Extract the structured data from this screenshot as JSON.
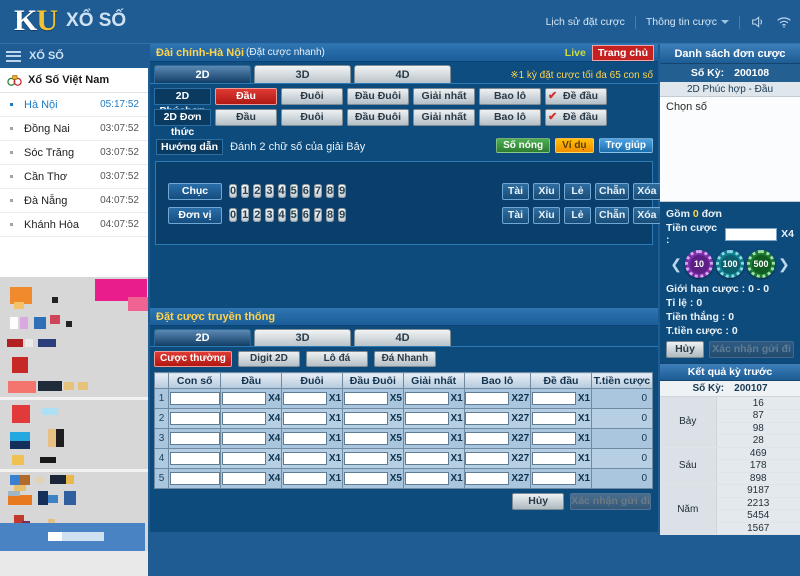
{
  "topbar": {
    "logo_main": "KU",
    "logo_sub": "XỔ SỐ",
    "links": [
      {
        "label": "Lịch sử đặt cược",
        "icon": ""
      },
      {
        "label": "Thông tin cược",
        "icon": "chevron-down-icon"
      }
    ],
    "icons": [
      "volume-icon",
      "wifi-icon"
    ]
  },
  "sidebar": {
    "header": "XỔ SỐ",
    "country": "Xổ Số Việt Nam",
    "provinces": [
      {
        "name": "Hà Nội",
        "time": "05:17:52",
        "active": true
      },
      {
        "name": "Đồng Nai",
        "time": "03:07:52",
        "active": false
      },
      {
        "name": "Sóc Trăng",
        "time": "03:07:52",
        "active": false
      },
      {
        "name": "Cần Thơ",
        "time": "03:07:52",
        "active": false
      },
      {
        "name": "Đà Nẵng",
        "time": "04:07:52",
        "active": false
      },
      {
        "name": "Khánh Hòa",
        "time": "04:07:52",
        "active": false
      }
    ]
  },
  "quickbet": {
    "title": "Đài chính-Hà Nội",
    "title_sub": "(Đặt cược nhanh)",
    "live_label": "Live",
    "home_label": "Trang chủ",
    "tabs": [
      {
        "label": "2D",
        "selected": true
      },
      {
        "label": "3D",
        "selected": false
      },
      {
        "label": "4D",
        "selected": false
      }
    ],
    "note": "※1 kỳ đặt cược tối đa 65 con số",
    "rows": [
      {
        "label": "2D Phúchợp",
        "buttons": [
          {
            "label": "Đầu",
            "style": "red"
          },
          {
            "label": "Đuôi",
            "style": "normal"
          },
          {
            "label": "Đầu Đuôi",
            "style": "normal"
          },
          {
            "label": "Giải nhất",
            "style": "normal"
          },
          {
            "label": "Bao lô",
            "style": "normal"
          },
          {
            "label": "Đề đầu",
            "style": "flag"
          }
        ]
      },
      {
        "label": "2D Đơn thức",
        "buttons": [
          {
            "label": "Đầu",
            "style": "normal"
          },
          {
            "label": "Đuôi",
            "style": "normal"
          },
          {
            "label": "Đầu Đuôi",
            "style": "normal"
          },
          {
            "label": "Giải nhất",
            "style": "normal"
          },
          {
            "label": "Bao lô",
            "style": "normal"
          },
          {
            "label": "Đề đầu",
            "style": "flag"
          }
        ]
      }
    ],
    "guide_tag": "Hướng dẫn",
    "guide_text": "Đánh 2 chữ số của giải Bảy",
    "guide_buttons": [
      {
        "label": "Số nóng",
        "color": "green"
      },
      {
        "label": "Ví dụ",
        "color": "orange"
      },
      {
        "label": "Trợ giúp",
        "color": "blue"
      }
    ],
    "pad": {
      "row1_name": "Chục",
      "row2_name": "Đơn vị",
      "digits": [
        "0",
        "1",
        "2",
        "3",
        "4",
        "5",
        "6",
        "7",
        "8",
        "9"
      ],
      "side_buttons": [
        "Tài",
        "Xỉu",
        "Lẻ",
        "Chẵn",
        "Xóa"
      ]
    }
  },
  "traditional": {
    "title": "Đặt cược truyền thống",
    "tabs": [
      {
        "label": "2D",
        "selected": true
      },
      {
        "label": "3D",
        "selected": false
      },
      {
        "label": "4D",
        "selected": false
      }
    ],
    "modes": [
      {
        "label": "Cược thường",
        "style": "red"
      },
      {
        "label": "Digit 2D",
        "style": "normal"
      },
      {
        "label": "Lô đá",
        "style": "normal"
      },
      {
        "label": "Đá Nhanh",
        "style": "normal"
      }
    ],
    "columns": [
      "",
      "Con số",
      "Đầu",
      "Đuôi",
      "Đầu Đuôi",
      "Giải nhất",
      "Bao lô",
      "Đề đầu",
      "T.tiền cược"
    ],
    "multipliers": {
      "dau": "X4",
      "duoi": "X1",
      "dauduoi": "X5",
      "giainhat": "X1",
      "baolo": "X27",
      "dedau": "X1"
    },
    "rows": [
      {
        "idx": "1",
        "con_so": "",
        "dau": "",
        "duoi": "",
        "dau_duoi": "",
        "giai_nhat": "",
        "bao_lo": "",
        "de_dau": "",
        "total": "0"
      },
      {
        "idx": "2",
        "con_so": "",
        "dau": "",
        "duoi": "",
        "dau_duoi": "",
        "giai_nhat": "",
        "bao_lo": "",
        "de_dau": "",
        "total": "0"
      },
      {
        "idx": "3",
        "con_so": "",
        "dau": "",
        "duoi": "",
        "dau_duoi": "",
        "giai_nhat": "",
        "bao_lo": "",
        "de_dau": "",
        "total": "0"
      },
      {
        "idx": "4",
        "con_so": "",
        "dau": "",
        "duoi": "",
        "dau_duoi": "",
        "giai_nhat": "",
        "bao_lo": "",
        "de_dau": "",
        "total": "0"
      },
      {
        "idx": "5",
        "con_so": "",
        "dau": "",
        "duoi": "",
        "dau_duoi": "",
        "giai_nhat": "",
        "bao_lo": "",
        "de_dau": "",
        "total": "0"
      }
    ],
    "cancel_label": "Hủy",
    "confirm_label": "Xác nhận gửi đi"
  },
  "rightpanel": {
    "title": "Danh sách đơn cược",
    "so_ky_label": "Số Kỳ:",
    "so_ky_value": "200108",
    "bet_type": "2D Phúc hợp - Đầu",
    "placeholder": "Chọn số",
    "gom_label": "Gồm",
    "gom_value": "0",
    "gom_suffix": "đơn",
    "tien_cuoc_label": "Tiền cược :",
    "tien_cuoc_value": "",
    "tien_cuoc_mult": "X4",
    "chips": [
      {
        "value": "10",
        "color": "#7b2fa8"
      },
      {
        "value": "100",
        "color": "#0f7f8f"
      },
      {
        "value": "500",
        "color": "#1b7a2f"
      }
    ],
    "gioi_han_label": "Giới hạn cược :",
    "gioi_han_value": "0 - 0",
    "ti_le_label": "Tỉ            lệ :",
    "ti_le_value": "0",
    "tien_thang_label": "Tiền thắng :",
    "tien_thang_value": "0",
    "ttien_label": "T.tiền cược :",
    "ttien_value": "0",
    "cancel_label": "Hủy",
    "confirm_label": "Xác nhận gửi đi",
    "results_title": "Kết quả kỳ trước",
    "results_so_ky_label": "Số Kỳ:",
    "results_so_ky_value": "200107",
    "results": [
      {
        "label": "Bảy",
        "values": [
          "16",
          "87",
          "98",
          "28"
        ]
      },
      {
        "label": "Sáu",
        "values": [
          "469",
          "178",
          "898"
        ]
      },
      {
        "label": "Năm",
        "values": [
          "9187",
          "2213",
          "5454",
          "1567"
        ]
      }
    ]
  }
}
